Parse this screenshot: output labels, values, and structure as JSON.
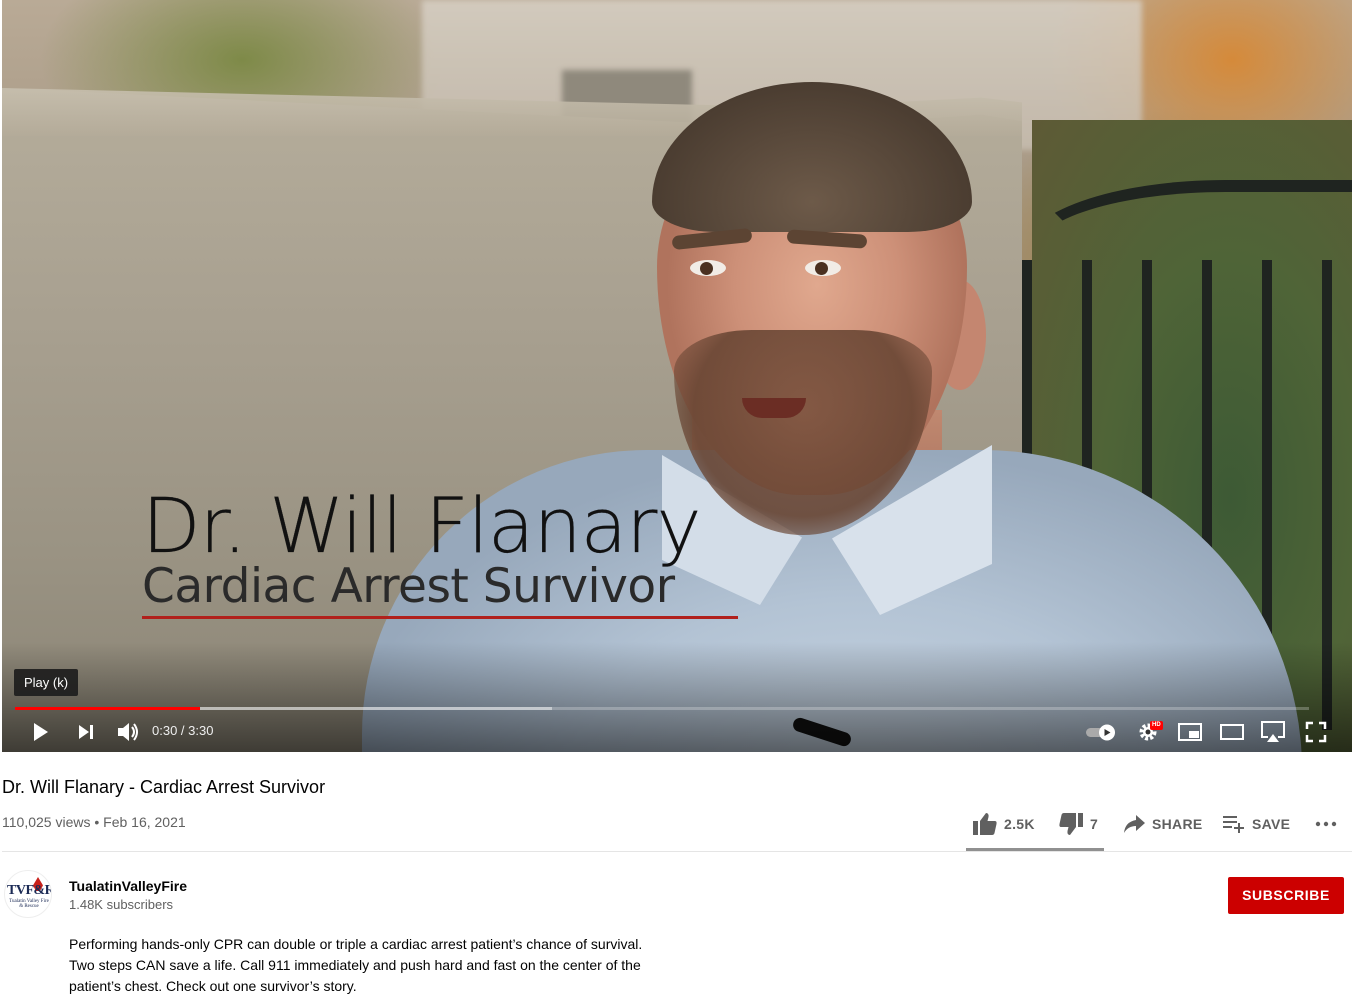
{
  "player": {
    "lower_third": {
      "name": "Dr. Will Flanary",
      "role": "Cardiac Arrest Survivor"
    },
    "tooltip": "Play (k)",
    "time_current": "0:30",
    "time_total": "3:30",
    "time_display": "0:30 / 3:30",
    "played_fraction": 0.143,
    "loaded_fraction": 0.415,
    "hd_badge": "HD",
    "icons": [
      "play-icon",
      "next-icon",
      "volume-icon",
      "autoplay-toggle-icon",
      "settings-icon",
      "miniplayer-icon",
      "theater-mode-icon",
      "cast-icon",
      "fullscreen-icon"
    ]
  },
  "video": {
    "title": "Dr. Will Flanary - Cardiac Arrest Survivor",
    "views": "110,025 views",
    "separator": "•",
    "date": "Feb 16, 2021"
  },
  "actions": {
    "likes": "2.5K",
    "dislikes": "7",
    "share": "SHARE",
    "save": "SAVE",
    "like_ratio": 0.997
  },
  "channel": {
    "name": "TualatinValleyFire",
    "subscribers": "1.48K subscribers",
    "avatar_text": "TVF&R",
    "avatar_subtext": "Tualatin Valley Fire & Rescue",
    "subscribe_label": "SUBSCRIBE"
  },
  "description": {
    "lines": [
      "Performing hands-only CPR can double or triple a cardiac arrest patient’s chance of survival.",
      "Two steps CAN save a life. Call 911 immediately and push hard and fast on the center of the",
      "patient’s chest. Check out one survivor’s story."
    ]
  },
  "colors": {
    "accent_red": "#cc0000",
    "progress_red": "#ff0000",
    "secondary_text": "#606060"
  }
}
